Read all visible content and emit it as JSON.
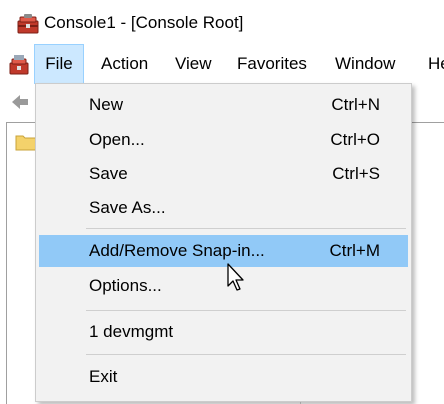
{
  "window": {
    "title": "Console1 - [Console Root]",
    "title_icon": "mmc-toolbox-icon"
  },
  "menubar": {
    "doc_icon": "mmc-document-icon",
    "items": [
      {
        "label": "File",
        "state": "open"
      },
      {
        "label": "Action"
      },
      {
        "label": "View"
      },
      {
        "label": "Favorites"
      },
      {
        "label": "Window"
      },
      {
        "label": "He"
      }
    ]
  },
  "file_menu": {
    "items": [
      {
        "label": "New",
        "shortcut": "Ctrl+N"
      },
      {
        "label": "Open...",
        "shortcut": "Ctrl+O"
      },
      {
        "label": "Save",
        "shortcut": "Ctrl+S"
      },
      {
        "label": "Save As...",
        "shortcut": ""
      },
      {
        "label": "Add/Remove Snap-in...",
        "shortcut": "Ctrl+M",
        "highlighted": true
      },
      {
        "label": "Options...",
        "shortcut": ""
      },
      {
        "label": "1 devmgmt",
        "shortcut": ""
      },
      {
        "label": "Exit",
        "shortcut": ""
      }
    ]
  },
  "colors": {
    "menu_bg": "#f2f2f2",
    "highlight": "#91c9f7",
    "file_active_bg": "#cce8ff",
    "file_active_border": "#99d1ff"
  },
  "icons": {
    "back": "back-arrow-icon",
    "folder": "folder-icon",
    "cursor": "mouse-pointer-icon"
  }
}
